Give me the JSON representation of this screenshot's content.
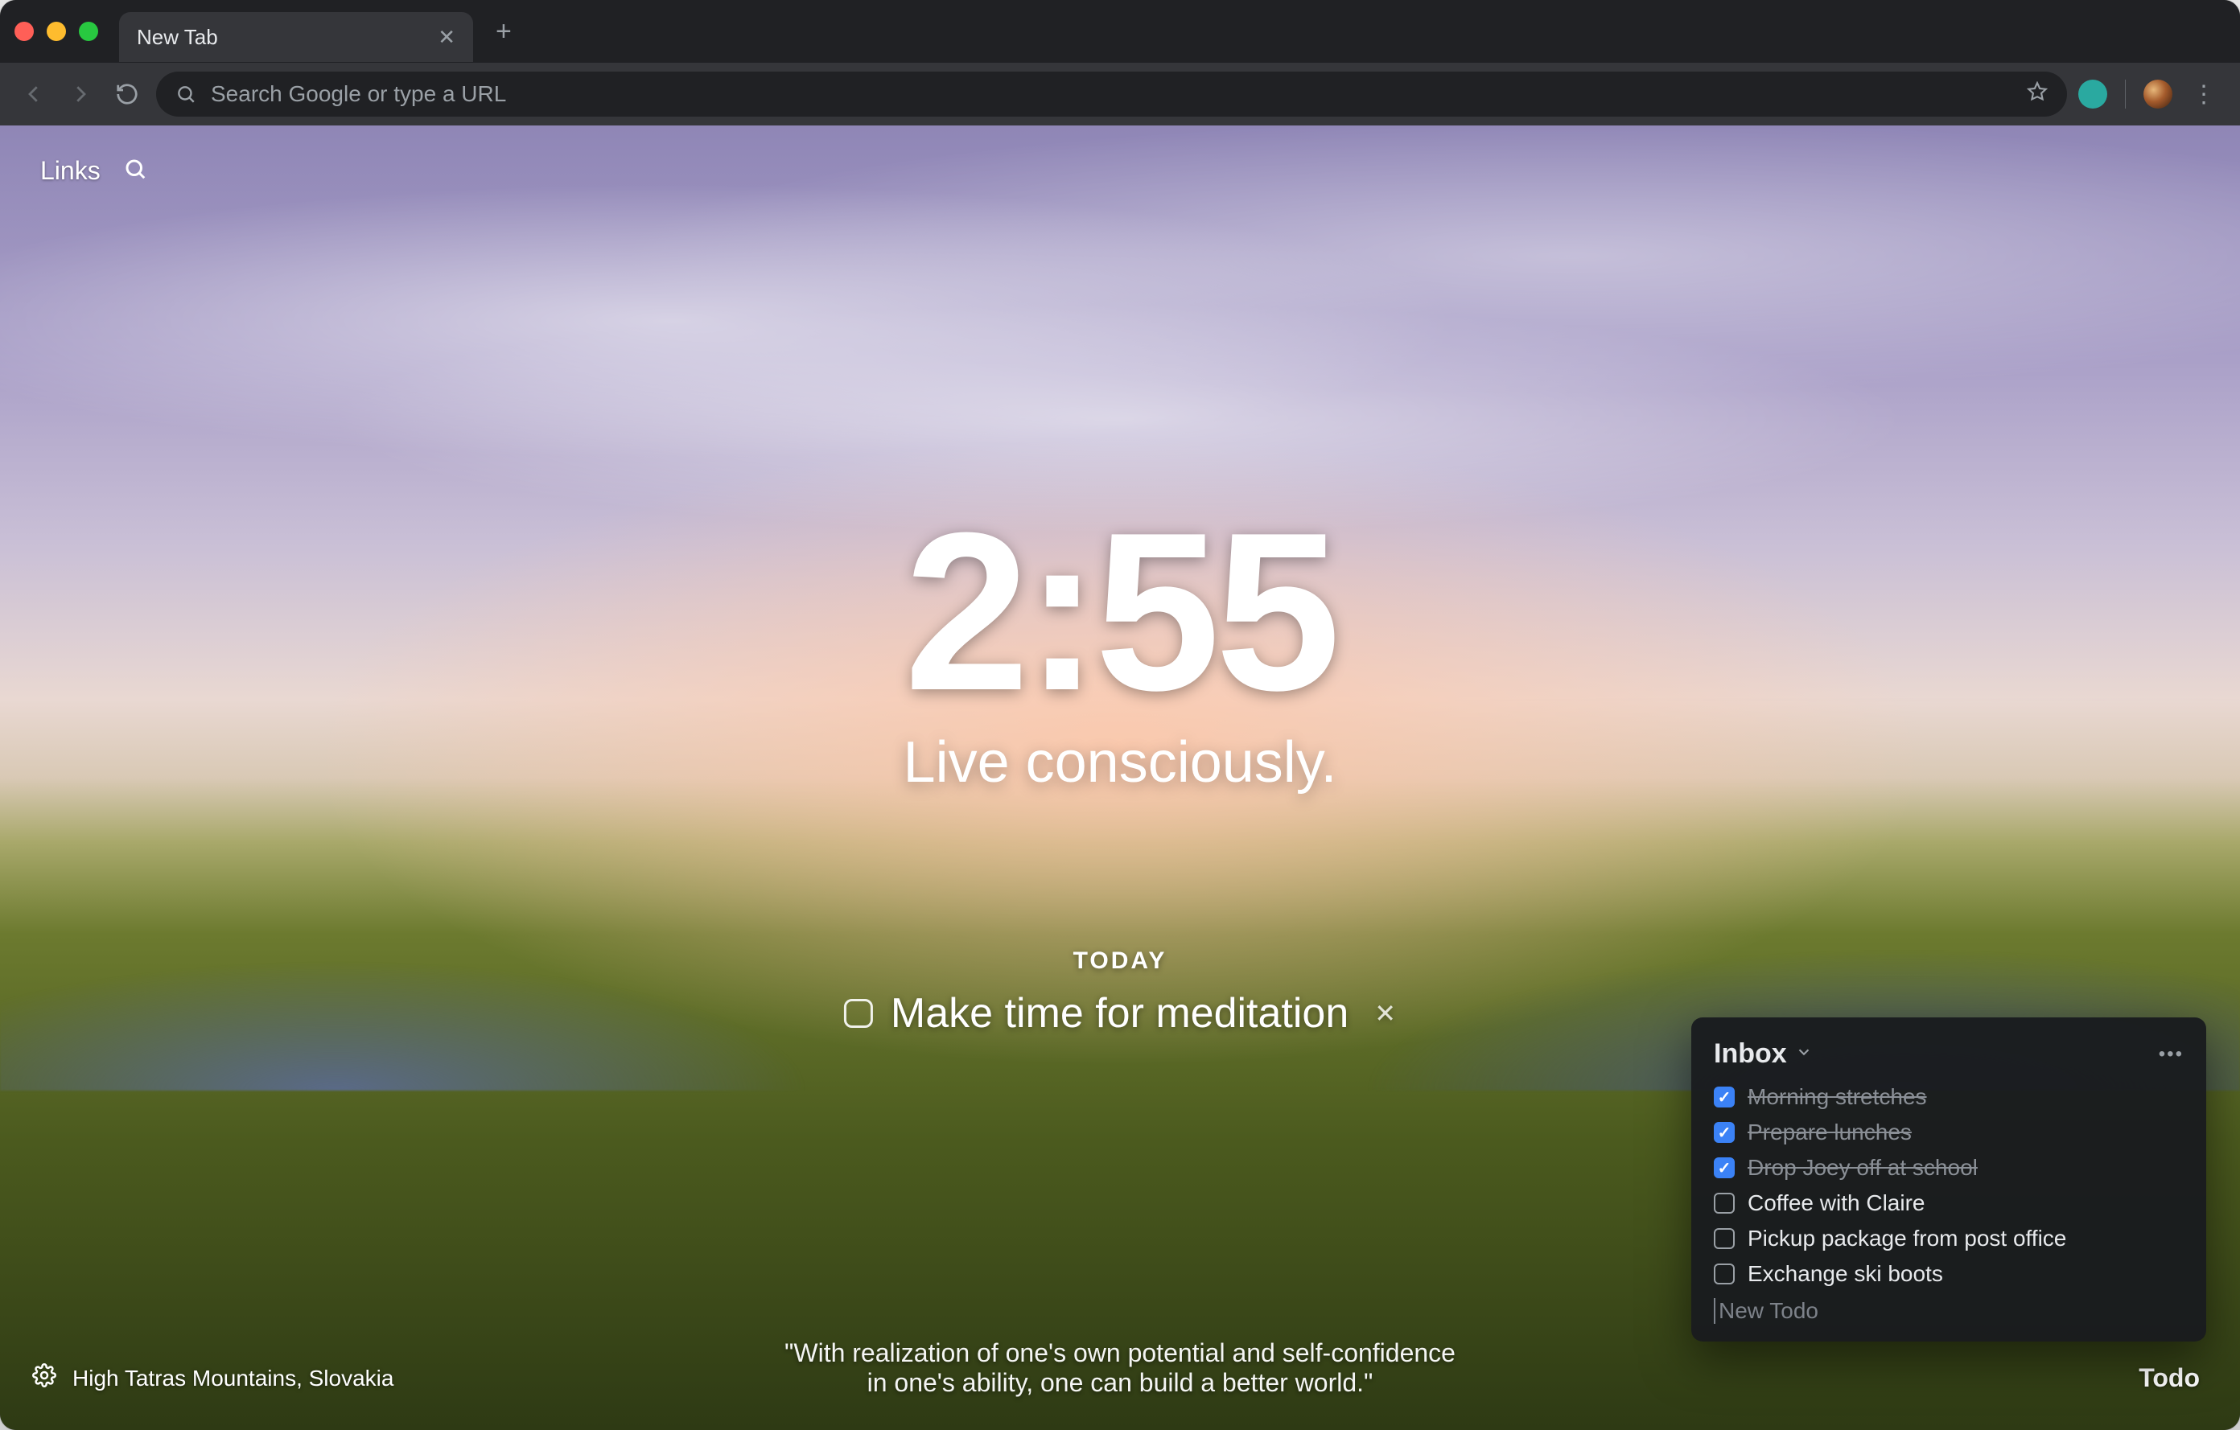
{
  "browser": {
    "tab_title": "New Tab",
    "omnibox_placeholder": "Search Google or type a URL"
  },
  "topbar": {
    "links_label": "Links"
  },
  "clock": {
    "time": "2:55",
    "mantra": "Live consciously."
  },
  "focus": {
    "label": "TODAY",
    "task": "Make time for meditation",
    "completed": false
  },
  "quote": {
    "line1": "\"With realization of one's own potential and self-confidence",
    "line2": "in one's ability, one can build a better world.\""
  },
  "photo": {
    "location": "High Tatras Mountains, Slovakia"
  },
  "todo": {
    "toggle_label": "Todo",
    "list_title": "Inbox",
    "new_placeholder": "New Todo",
    "items": [
      {
        "label": "Morning stretches",
        "done": true
      },
      {
        "label": "Prepare lunches",
        "done": true
      },
      {
        "label": "Drop Joey off at school",
        "done": true
      },
      {
        "label": "Coffee with Claire",
        "done": false
      },
      {
        "label": "Pickup package from post office",
        "done": false
      },
      {
        "label": "Exchange ski boots",
        "done": false
      }
    ]
  }
}
